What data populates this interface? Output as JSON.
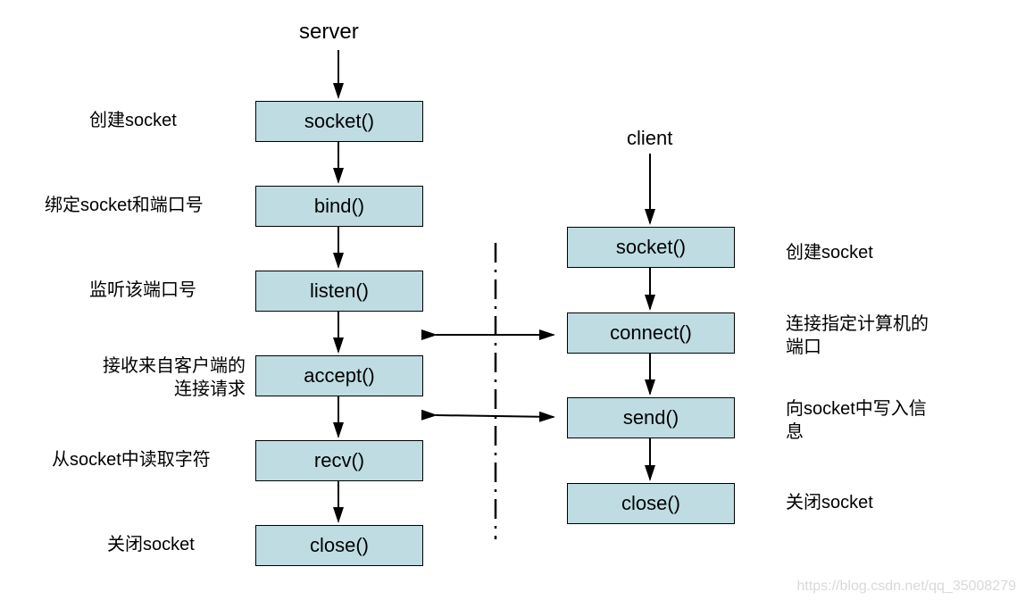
{
  "server": {
    "title": "server",
    "boxes": {
      "socket": "socket()",
      "bind": "bind()",
      "listen": "listen()",
      "accept": "accept()",
      "recv": "recv()",
      "close": "close()"
    },
    "labels": {
      "socket": "创建socket",
      "bind": "绑定socket和端口号",
      "listen": "监听该端口号",
      "accept": "接收来自客户端的\n连接请求",
      "recv": "从socket中读取字符",
      "close": "关闭socket"
    }
  },
  "client": {
    "title": "client",
    "boxes": {
      "socket": "socket()",
      "connect": "connect()",
      "send": "send()",
      "close": "close()"
    },
    "labels": {
      "socket": "创建socket",
      "connect": "连接指定计算机的\n端口",
      "send": "向socket中写入信\n息",
      "close": "关闭socket"
    }
  },
  "watermark": "https://blog.csdn.net/qq_35008279"
}
